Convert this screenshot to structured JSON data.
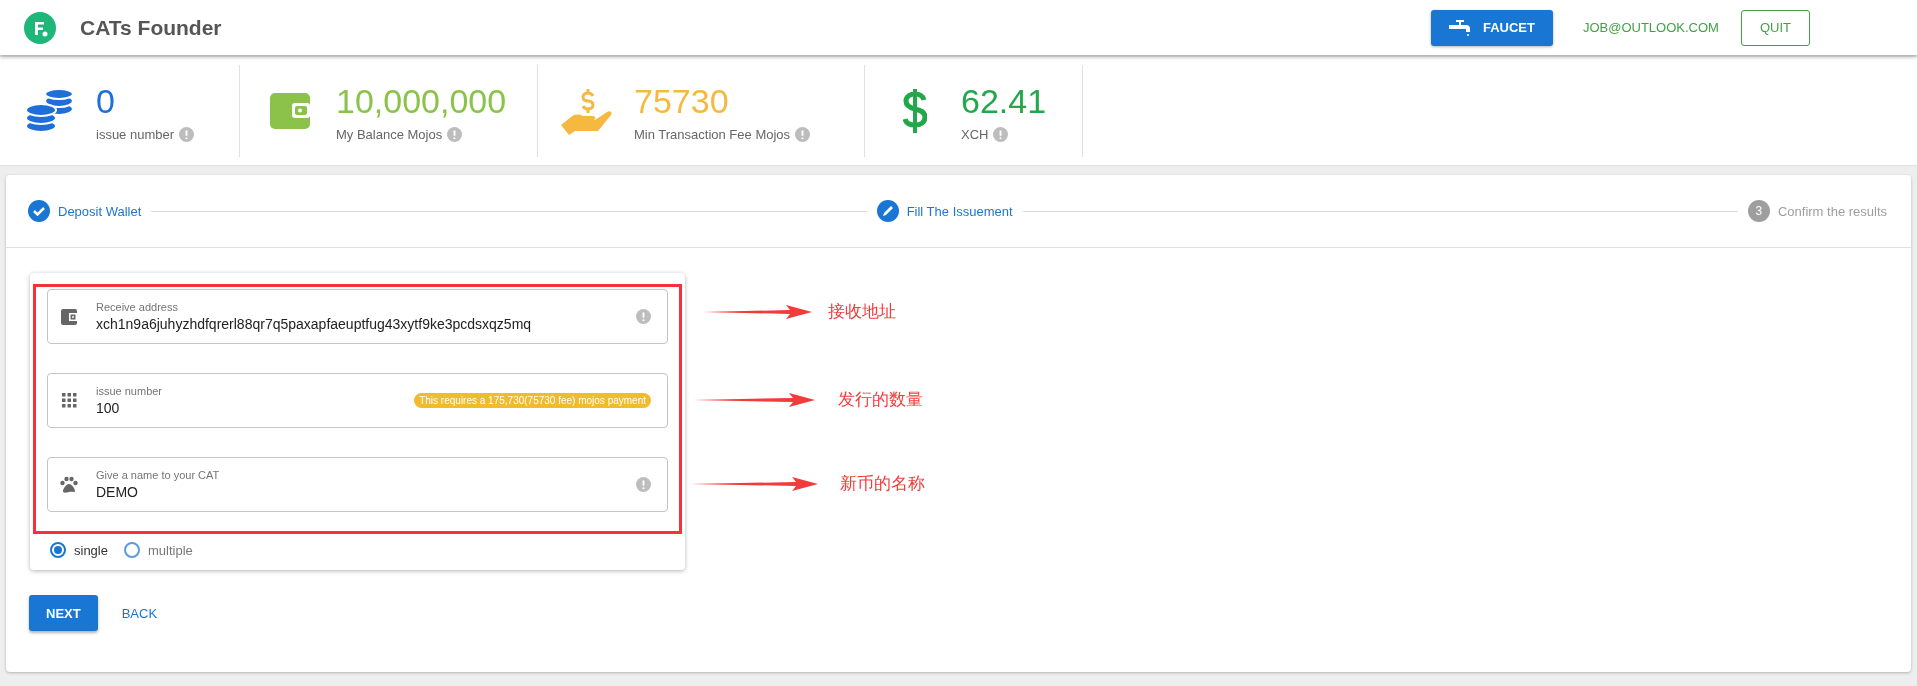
{
  "header": {
    "title": "CATs Founder",
    "faucet_button": "FAUCET",
    "account": "JOB@OUTLOOK.COM",
    "quit_button": "QUIT"
  },
  "stats": [
    {
      "kind": "coins",
      "value": "0",
      "label": "issue number",
      "color": "#1e6fd9"
    },
    {
      "kind": "wallet",
      "value": "10,000,000",
      "label": "My Balance Mojos",
      "color": "#8bc34a"
    },
    {
      "kind": "hand",
      "value": "75730",
      "label": "Min Transaction Fee Mojos",
      "color": "#f4b93e"
    },
    {
      "kind": "dollar",
      "value": "62.41",
      "label": "XCH",
      "color": "#22a84a"
    }
  ],
  "stepper": [
    {
      "label": "Deposit Wallet",
      "kind": "done"
    },
    {
      "label": "Fill The Issuement",
      "kind": "active"
    },
    {
      "label": "Confirm the results",
      "kind": "pending",
      "number": "3"
    }
  ],
  "form": {
    "fields": [
      {
        "kind": "address",
        "label": "Receive address",
        "value": "xch1n9a6juhyzhdfqrerl88qr7q5paxapfaeuptfug43xytf9ke3pcdsxqz5mq"
      },
      {
        "kind": "number",
        "label": "issue number",
        "value": "100",
        "badge": "This requires a 175,730(75730 fee) mojos payment"
      },
      {
        "kind": "name",
        "label": "Give a name to your CAT",
        "value": "DEMO"
      }
    ],
    "radios": [
      {
        "label": "single",
        "selected": true
      },
      {
        "label": "multiple",
        "selected": false
      }
    ]
  },
  "actions": {
    "next_button": "NEXT",
    "back_button": "BACK"
  },
  "annotations": [
    {
      "label": "接收地址"
    },
    {
      "label": "发行的数量"
    },
    {
      "label": "新币的名称"
    }
  ]
}
